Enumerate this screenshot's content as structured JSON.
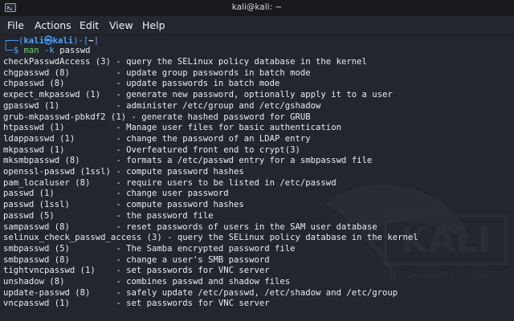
{
  "window": {
    "title": "kali@kali: ~"
  },
  "menu": [
    {
      "label": "File"
    },
    {
      "label": "Actions"
    },
    {
      "label": "Edit"
    },
    {
      "label": "View"
    },
    {
      "label": "Help"
    }
  ],
  "prompt": {
    "top_open": "┌──(",
    "user": "kali㉿kali",
    "top_mid": ")-[",
    "cwd": "~",
    "top_close": "]",
    "bottom": "└─$ ",
    "cmd": "man",
    "flag": "-k",
    "arg": "passwd"
  },
  "watermark": {
    "logo_text": "KALI",
    "tagline": "BY OFFENSIVE SECURITY"
  },
  "output": [
    "checkPasswdAccess (3) - query the SELinux policy database in the kernel",
    "chgpasswd (8)         - update group passwords in batch mode",
    "chpasswd (8)          - update passwords in batch mode",
    "expect_mkpasswd (1)   - generate new password, optionally apply it to a user",
    "gpasswd (1)           - administer /etc/group and /etc/gshadow",
    "grub-mkpasswd-pbkdf2 (1) - generate hashed password for GRUB",
    "htpasswd (1)          - Manage user files for basic authentication",
    "ldappasswd (1)        - change the password of an LDAP entry",
    "mkpasswd (1)          - Overfeatured front end to crypt(3)",
    "mksmbpasswd (8)       - formats a /etc/passwd entry for a smbpasswd file",
    "openssl-passwd (1ssl) - compute password hashes",
    "pam_localuser (8)     - require users to be listed in /etc/passwd",
    "passwd (1)            - change user password",
    "passwd (1ssl)         - compute password hashes",
    "passwd (5)            - the password file",
    "sampasswd (8)         - reset passwords of users in the SAM user database",
    "selinux_check_passwd_access (3) - query the SELinux policy database in the kernel",
    "smbpasswd (5)         - The Samba encrypted password file",
    "smbpasswd (8)         - change a user's SMB password",
    "tightvncpasswd (1)    - set passwords for VNC server",
    "unshadow (8)          - combines passwd and shadow files",
    "update-passwd (8)     - safely update /etc/passwd, /etc/shadow and /etc/group",
    "vncpasswd (1)         - set passwords for VNC server"
  ]
}
